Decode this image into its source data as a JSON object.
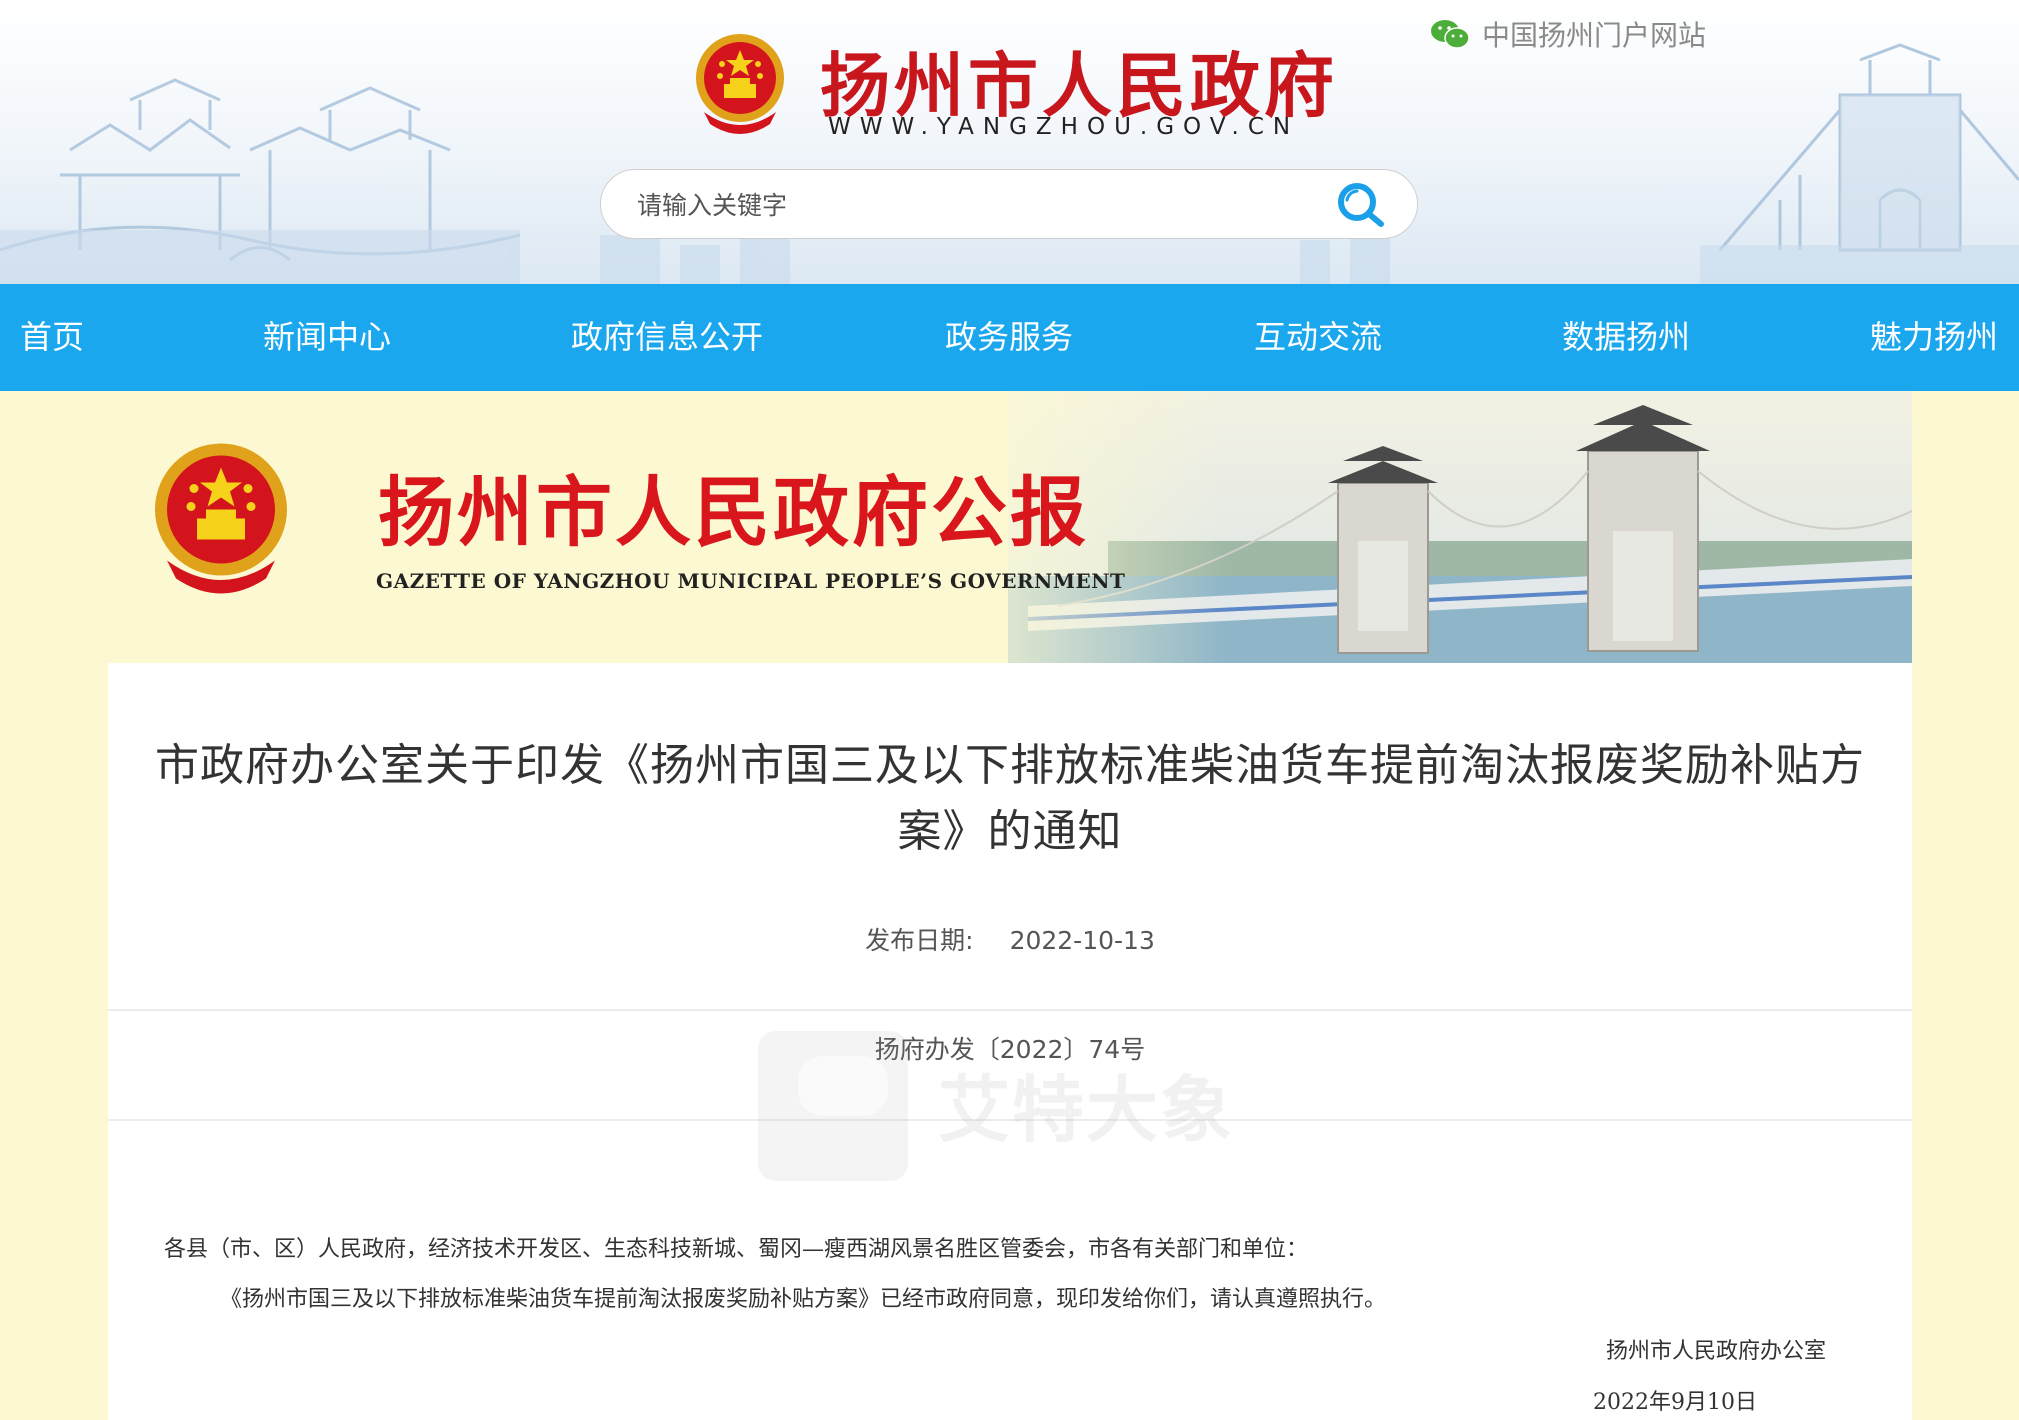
{
  "header": {
    "title": "扬州市人民政府",
    "url": "WWW.YANGZHOU.GOV.CN",
    "portal_link": "中国扬州门户网站",
    "search_placeholder": "请输入关键字"
  },
  "nav": {
    "items": [
      {
        "label": "首页"
      },
      {
        "label": "新闻中心"
      },
      {
        "label": "政府信息公开"
      },
      {
        "label": "政务服务"
      },
      {
        "label": "互动交流"
      },
      {
        "label": "数据扬州"
      },
      {
        "label": "魅力扬州"
      }
    ]
  },
  "banner": {
    "title": "扬州市人民政府公报",
    "subtitle": "GAZETTE OF YANGZHOU MUNICIPAL PEOPLE’S GOVERNMENT"
  },
  "article": {
    "title": "市政府办公室关于印发《扬州市国三及以下排放标准柴油货车提前淘汰报废奖励补贴方案》的通知",
    "publish_label": "发布日期:",
    "publish_date": "2022-10-13",
    "doc_number": "扬府办发〔2022〕74号",
    "salutation": "各县（市、区）人民政府，经济技术开发区、生态科技新城、蜀冈—瘦西湖风景名胜区管委会，市各有关部门和单位：",
    "paragraph": "《扬州市国三及以下排放标准柴油货车提前淘汰报废奖励补贴方案》已经市政府同意，现印发给你们，请认真遵照执行。",
    "signature": "扬州市人民政府办公室",
    "sign_date": "2022年9月10日"
  },
  "watermark": "艾特大象",
  "colors": {
    "nav_bg": "#1aa7ee",
    "title_red": "#c8161d",
    "page_bg": "#fcf9d2"
  }
}
